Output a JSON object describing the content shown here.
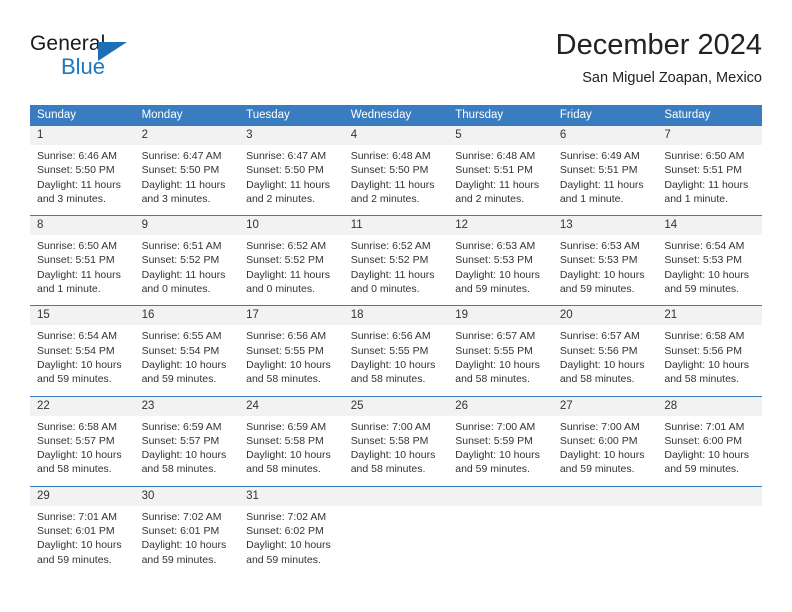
{
  "brand": {
    "name_part1": "General",
    "name_part2": "Blue",
    "triangle_color": "#1f6fb5",
    "blue_text_color": "#1f77bd"
  },
  "header": {
    "title": "December 2024",
    "subtitle": "San Miguel Zoapan, Mexico"
  },
  "theme": {
    "header_row_bg": "#3a7cc0",
    "header_row_text": "#ffffff",
    "daynum_band_bg": "#f2f2f2",
    "cell_bg": "#ffffff",
    "text_color": "#333333"
  },
  "weekday_headers": [
    "Sunday",
    "Monday",
    "Tuesday",
    "Wednesday",
    "Thursday",
    "Friday",
    "Saturday"
  ],
  "weeks": [
    [
      {
        "day": "1",
        "sunrise": "Sunrise: 6:46 AM",
        "sunset": "Sunset: 5:50 PM",
        "daylight1": "Daylight: 11 hours",
        "daylight2": "and 3 minutes."
      },
      {
        "day": "2",
        "sunrise": "Sunrise: 6:47 AM",
        "sunset": "Sunset: 5:50 PM",
        "daylight1": "Daylight: 11 hours",
        "daylight2": "and 3 minutes."
      },
      {
        "day": "3",
        "sunrise": "Sunrise: 6:47 AM",
        "sunset": "Sunset: 5:50 PM",
        "daylight1": "Daylight: 11 hours",
        "daylight2": "and 2 minutes."
      },
      {
        "day": "4",
        "sunrise": "Sunrise: 6:48 AM",
        "sunset": "Sunset: 5:50 PM",
        "daylight1": "Daylight: 11 hours",
        "daylight2": "and 2 minutes."
      },
      {
        "day": "5",
        "sunrise": "Sunrise: 6:48 AM",
        "sunset": "Sunset: 5:51 PM",
        "daylight1": "Daylight: 11 hours",
        "daylight2": "and 2 minutes."
      },
      {
        "day": "6",
        "sunrise": "Sunrise: 6:49 AM",
        "sunset": "Sunset: 5:51 PM",
        "daylight1": "Daylight: 11 hours",
        "daylight2": "and 1 minute."
      },
      {
        "day": "7",
        "sunrise": "Sunrise: 6:50 AM",
        "sunset": "Sunset: 5:51 PM",
        "daylight1": "Daylight: 11 hours",
        "daylight2": "and 1 minute."
      }
    ],
    [
      {
        "day": "8",
        "sunrise": "Sunrise: 6:50 AM",
        "sunset": "Sunset: 5:51 PM",
        "daylight1": "Daylight: 11 hours",
        "daylight2": "and 1 minute."
      },
      {
        "day": "9",
        "sunrise": "Sunrise: 6:51 AM",
        "sunset": "Sunset: 5:52 PM",
        "daylight1": "Daylight: 11 hours",
        "daylight2": "and 0 minutes."
      },
      {
        "day": "10",
        "sunrise": "Sunrise: 6:52 AM",
        "sunset": "Sunset: 5:52 PM",
        "daylight1": "Daylight: 11 hours",
        "daylight2": "and 0 minutes."
      },
      {
        "day": "11",
        "sunrise": "Sunrise: 6:52 AM",
        "sunset": "Sunset: 5:52 PM",
        "daylight1": "Daylight: 11 hours",
        "daylight2": "and 0 minutes."
      },
      {
        "day": "12",
        "sunrise": "Sunrise: 6:53 AM",
        "sunset": "Sunset: 5:53 PM",
        "daylight1": "Daylight: 10 hours",
        "daylight2": "and 59 minutes."
      },
      {
        "day": "13",
        "sunrise": "Sunrise: 6:53 AM",
        "sunset": "Sunset: 5:53 PM",
        "daylight1": "Daylight: 10 hours",
        "daylight2": "and 59 minutes."
      },
      {
        "day": "14",
        "sunrise": "Sunrise: 6:54 AM",
        "sunset": "Sunset: 5:53 PM",
        "daylight1": "Daylight: 10 hours",
        "daylight2": "and 59 minutes."
      }
    ],
    [
      {
        "day": "15",
        "sunrise": "Sunrise: 6:54 AM",
        "sunset": "Sunset: 5:54 PM",
        "daylight1": "Daylight: 10 hours",
        "daylight2": "and 59 minutes."
      },
      {
        "day": "16",
        "sunrise": "Sunrise: 6:55 AM",
        "sunset": "Sunset: 5:54 PM",
        "daylight1": "Daylight: 10 hours",
        "daylight2": "and 59 minutes."
      },
      {
        "day": "17",
        "sunrise": "Sunrise: 6:56 AM",
        "sunset": "Sunset: 5:55 PM",
        "daylight1": "Daylight: 10 hours",
        "daylight2": "and 58 minutes."
      },
      {
        "day": "18",
        "sunrise": "Sunrise: 6:56 AM",
        "sunset": "Sunset: 5:55 PM",
        "daylight1": "Daylight: 10 hours",
        "daylight2": "and 58 minutes."
      },
      {
        "day": "19",
        "sunrise": "Sunrise: 6:57 AM",
        "sunset": "Sunset: 5:55 PM",
        "daylight1": "Daylight: 10 hours",
        "daylight2": "and 58 minutes."
      },
      {
        "day": "20",
        "sunrise": "Sunrise: 6:57 AM",
        "sunset": "Sunset: 5:56 PM",
        "daylight1": "Daylight: 10 hours",
        "daylight2": "and 58 minutes."
      },
      {
        "day": "21",
        "sunrise": "Sunrise: 6:58 AM",
        "sunset": "Sunset: 5:56 PM",
        "daylight1": "Daylight: 10 hours",
        "daylight2": "and 58 minutes."
      }
    ],
    [
      {
        "day": "22",
        "sunrise": "Sunrise: 6:58 AM",
        "sunset": "Sunset: 5:57 PM",
        "daylight1": "Daylight: 10 hours",
        "daylight2": "and 58 minutes."
      },
      {
        "day": "23",
        "sunrise": "Sunrise: 6:59 AM",
        "sunset": "Sunset: 5:57 PM",
        "daylight1": "Daylight: 10 hours",
        "daylight2": "and 58 minutes."
      },
      {
        "day": "24",
        "sunrise": "Sunrise: 6:59 AM",
        "sunset": "Sunset: 5:58 PM",
        "daylight1": "Daylight: 10 hours",
        "daylight2": "and 58 minutes."
      },
      {
        "day": "25",
        "sunrise": "Sunrise: 7:00 AM",
        "sunset": "Sunset: 5:58 PM",
        "daylight1": "Daylight: 10 hours",
        "daylight2": "and 58 minutes."
      },
      {
        "day": "26",
        "sunrise": "Sunrise: 7:00 AM",
        "sunset": "Sunset: 5:59 PM",
        "daylight1": "Daylight: 10 hours",
        "daylight2": "and 59 minutes."
      },
      {
        "day": "27",
        "sunrise": "Sunrise: 7:00 AM",
        "sunset": "Sunset: 6:00 PM",
        "daylight1": "Daylight: 10 hours",
        "daylight2": "and 59 minutes."
      },
      {
        "day": "28",
        "sunrise": "Sunrise: 7:01 AM",
        "sunset": "Sunset: 6:00 PM",
        "daylight1": "Daylight: 10 hours",
        "daylight2": "and 59 minutes."
      }
    ],
    [
      {
        "day": "29",
        "sunrise": "Sunrise: 7:01 AM",
        "sunset": "Sunset: 6:01 PM",
        "daylight1": "Daylight: 10 hours",
        "daylight2": "and 59 minutes."
      },
      {
        "day": "30",
        "sunrise": "Sunrise: 7:02 AM",
        "sunset": "Sunset: 6:01 PM",
        "daylight1": "Daylight: 10 hours",
        "daylight2": "and 59 minutes."
      },
      {
        "day": "31",
        "sunrise": "Sunrise: 7:02 AM",
        "sunset": "Sunset: 6:02 PM",
        "daylight1": "Daylight: 10 hours",
        "daylight2": "and 59 minutes."
      },
      {
        "day": "",
        "sunrise": "",
        "sunset": "",
        "daylight1": "",
        "daylight2": ""
      },
      {
        "day": "",
        "sunrise": "",
        "sunset": "",
        "daylight1": "",
        "daylight2": ""
      },
      {
        "day": "",
        "sunrise": "",
        "sunset": "",
        "daylight1": "",
        "daylight2": ""
      },
      {
        "day": "",
        "sunrise": "",
        "sunset": "",
        "daylight1": "",
        "daylight2": ""
      }
    ]
  ]
}
